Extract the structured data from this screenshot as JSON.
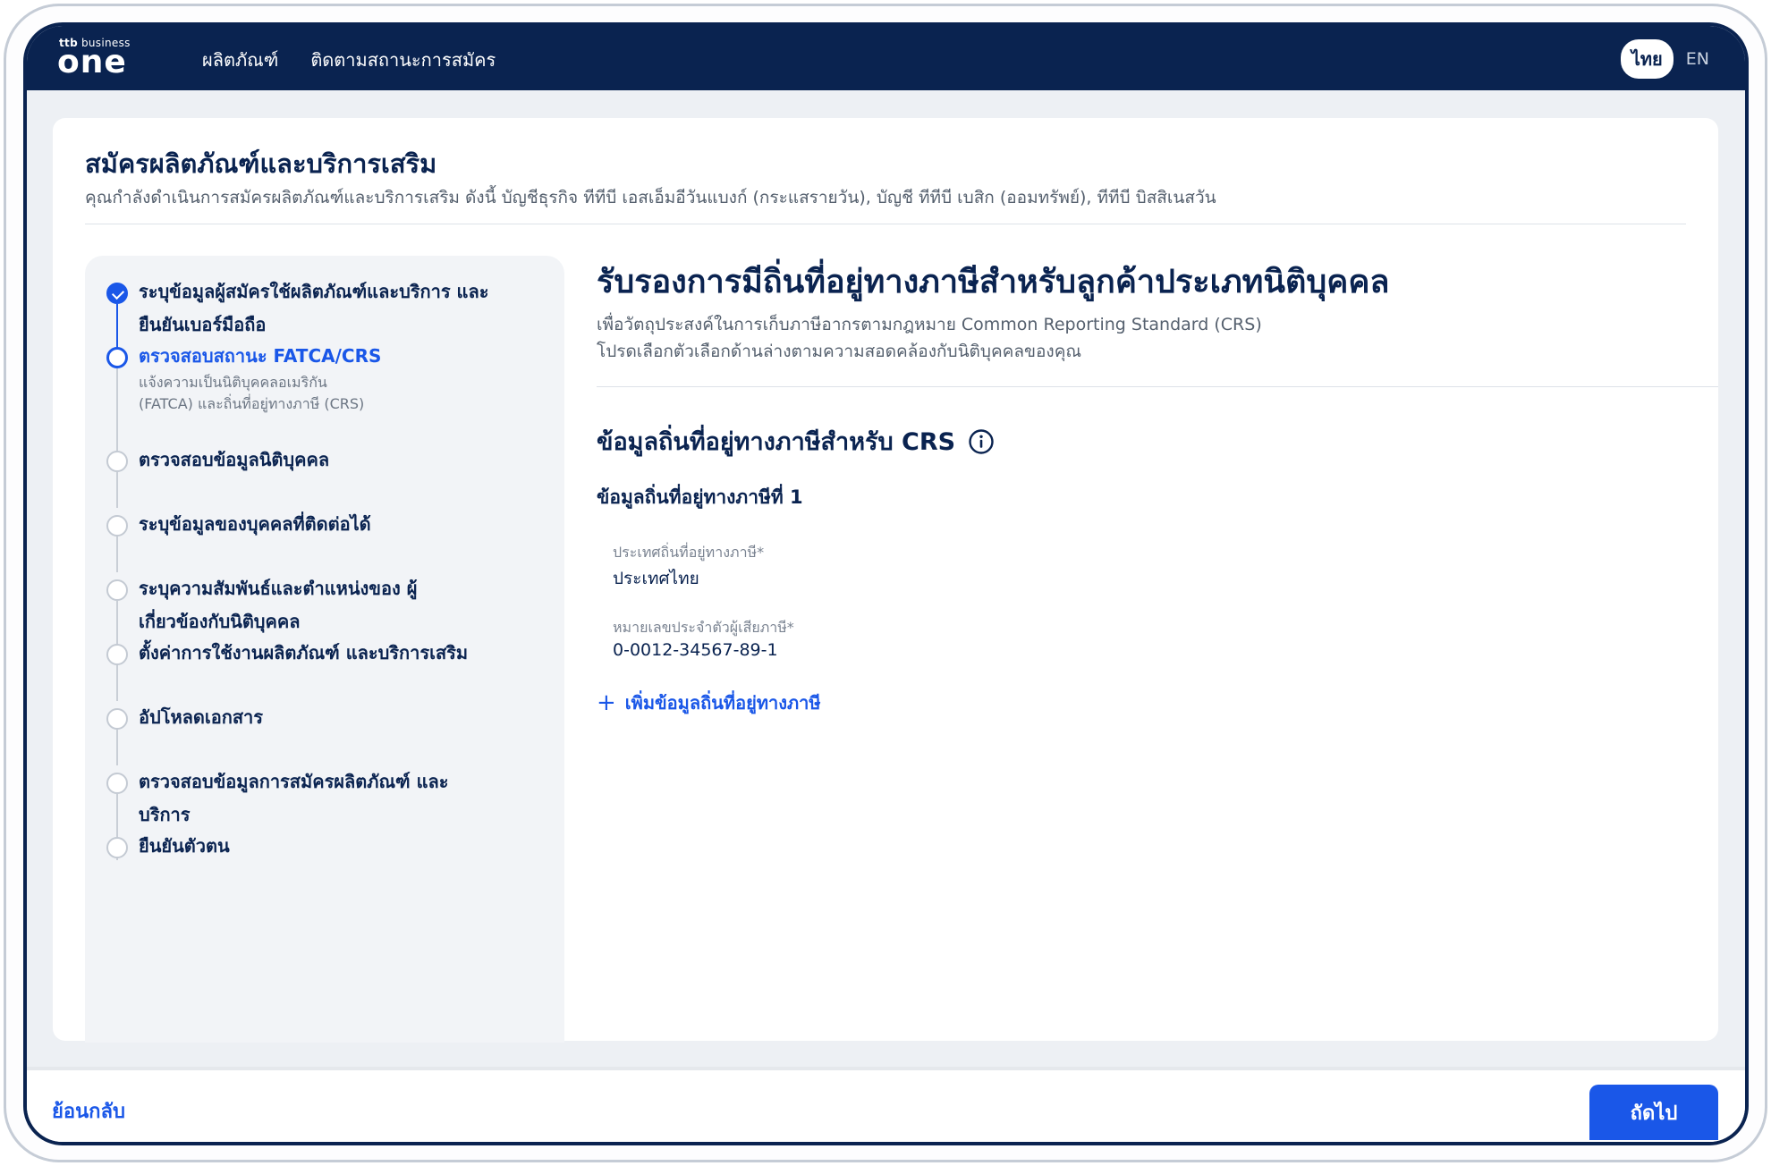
{
  "header": {
    "logo_small_brand": "ttb",
    "logo_small_text": "business",
    "logo_big_text": "one",
    "nav": [
      "ผลิตภัณฑ์",
      "ติดตามสถานะการสมัคร"
    ],
    "lang_active": "ไทย",
    "lang_other": "EN"
  },
  "page": {
    "title": "สมัครผลิตภัณฑ์และบริการเสริม",
    "subtitle": "คุณกำลังดำเนินการสมัครผลิตภัณฑ์และบริการเสริม ดังนี้  บัญชีธุรกิจ ทีทีบี เอสเอ็มอีวันแบงก์ (กระแสรายวัน),  บัญชี ทีทีบี เบสิก (ออมทรัพย์),  ทีทีบี บิสสิเนสวัน"
  },
  "steps": [
    {
      "label": "ระบุข้อมูลผู้สมัครใช้ผลิตภัณฑ์และบริการ และยืนยันเบอร์มือถือ",
      "state": "done"
    },
    {
      "label": "ตรวจสอบสถานะ FATCA/CRS",
      "state": "current",
      "desc": "แจ้งความเป็นนิติบุคคลอเมริกัน (FATCA) และถิ่นที่อยู่ทางภาษี (CRS)"
    },
    {
      "label": "ตรวจสอบข้อมูลนิติบุคคล",
      "state": "pending"
    },
    {
      "label": "ระบุข้อมูลของบุคคลที่ติดต่อได้",
      "state": "pending"
    },
    {
      "label": "ระบุความสัมพันธ์และตำแหน่งของ ผู้เกี่ยวข้องกับนิติบุคคล",
      "state": "pending"
    },
    {
      "label": "ตั้งค่าการใช้งานผลิตภัณฑ์ และบริการเสริม",
      "state": "pending"
    },
    {
      "label": "อัปโหลดเอกสาร",
      "state": "pending"
    },
    {
      "label": "ตรวจสอบข้อมูลการสมัครผลิตภัณฑ์ และบริการ",
      "state": "pending"
    },
    {
      "label": "ยืนยันตัวตน",
      "state": "pending"
    }
  ],
  "content": {
    "title": "รับรองการมีถิ่นที่อยู่ทางภาษีสำหรับลูกค้าประเภทนิติบุคคล",
    "line1": "เพื่อวัตถุประสงค์ในการเก็บภาษีอากรตามกฎหมาย  Common Reporting Standard (CRS)",
    "line2": "โปรดเลือกตัวเลือกด้านล่างตามความสอดคล้องกับนิติบุคคลของคุณ",
    "section_title": "ข้อมูลถิ่นที่อยู่ทางภาษีสำหรับ CRS",
    "residence_title": "ข้อมูลถิ่นที่อยู่ทางภาษีที่ 1",
    "country_label": "ประเทศถิ่นที่อยู่ทางภาษี*",
    "country_value": "ประเทศไทย",
    "tin_label": "หมายเลขประจำตัวผู้เสียภาษี*",
    "tin_value": "0-0012-34567-89-1",
    "add_label": "เพิ่มข้อมูลถิ่นที่อยู่ทางภาษี"
  },
  "footer": {
    "back_label": "ย้อนกลับ",
    "next_label": "ถัดไป"
  },
  "colors": {
    "navy": "#0a2350",
    "accent": "#1a57e8"
  }
}
